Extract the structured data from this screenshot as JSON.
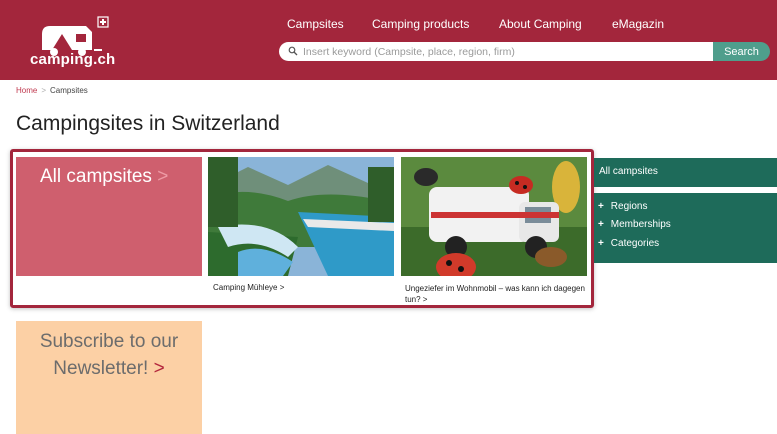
{
  "header": {
    "logo_text": "camping.ch",
    "nav": [
      "Campsites",
      "Camping products",
      "About Camping",
      "eMagazin"
    ],
    "search_placeholder": "Insert keyword (Campsite, place, region, firm)",
    "search_button": "Search"
  },
  "breadcrumb": {
    "home": "Home",
    "separator": ">",
    "current": "Campsites"
  },
  "page_title": "Campingsites in Switzerland",
  "tiles": {
    "all_label": "All campsites",
    "arrow": ">",
    "captions": [
      "Camping Mühleye >",
      "Ungeziefer im Wohnmobil – was kann ich dagegen tun? >"
    ]
  },
  "sidebar": {
    "top": "All campsites",
    "items": [
      "Regions",
      "Memberships",
      "Categories"
    ],
    "plus": "+"
  },
  "newsletter": {
    "line1": "Subscribe to our",
    "line2": "Newsletter!",
    "arrow": ">"
  },
  "colors": {
    "brand": "#a3263c",
    "green": "#1e6b5a",
    "search_btn": "#4f9e8c",
    "tile_pink": "#cf5f6e",
    "newsletter_bg": "#fcd0a5"
  }
}
